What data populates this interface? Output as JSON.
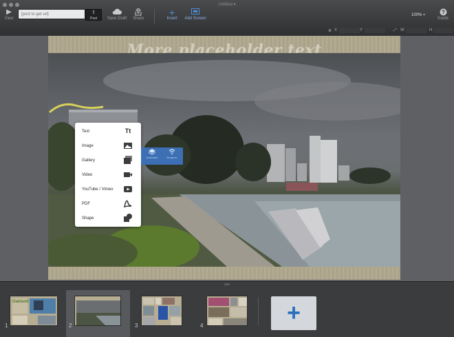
{
  "window": {
    "title": "Untitled ▾"
  },
  "toolbar": {
    "view_label": "View",
    "url_placeholder": "[post to get url]",
    "post_label": "Post",
    "save_draft_label": "Save Draft",
    "share_label": "Share",
    "insert_label": "Insert",
    "add_screen_label": "Add Screen",
    "zoom_value": "100%",
    "guide_label": "Guide"
  },
  "properties": {
    "x_label": "X",
    "y_label": "Y",
    "w_label": "W",
    "h_label": "H"
  },
  "slide": {
    "title": "More placeholder text"
  },
  "insert_menu": {
    "items": [
      {
        "label": "Text",
        "icon": "text-icon"
      },
      {
        "label": "Image",
        "icon": "image-icon"
      },
      {
        "label": "Gallery",
        "icon": "gallery-icon"
      },
      {
        "label": "Video",
        "icon": "video-icon"
      },
      {
        "label": "YouTube / Vimeo",
        "icon": "youtube-icon"
      },
      {
        "label": "PDF",
        "icon": "pdf-icon"
      },
      {
        "label": "Shape",
        "icon": "shape-icon"
      }
    ],
    "text_icon_glyph": "Tt"
  },
  "submenu": {
    "option_1": "Unlimited",
    "option_2": "Dropbox"
  },
  "filmstrip": {
    "slides": [
      {
        "number": "1",
        "thumb_text": "Oakland"
      },
      {
        "number": "2"
      },
      {
        "number": "3"
      },
      {
        "number": "4"
      }
    ],
    "active_slide": "2",
    "add_glyph": "+"
  },
  "colors": {
    "accent": "#2a6fbd",
    "toolbar_active": "#4d8fe0",
    "menu_submenu": "#3d6fb5"
  }
}
